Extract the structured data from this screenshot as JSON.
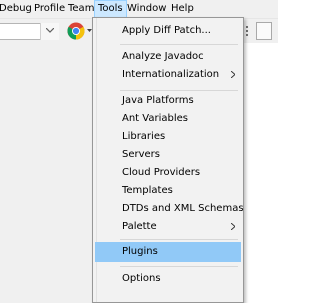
{
  "menubar": {
    "items": [
      "Debug",
      "Profile",
      "Team",
      "Tools",
      "Window",
      "Help"
    ]
  },
  "tools_menu": {
    "items": [
      {
        "label": "Apply Diff Patch...",
        "submenu": false
      },
      {
        "label": "Analyze Javadoc",
        "submenu": false
      },
      {
        "label": "Internationalization",
        "submenu": true
      },
      {
        "label": "Java Platforms",
        "submenu": false
      },
      {
        "label": "Ant Variables",
        "submenu": false
      },
      {
        "label": "Libraries",
        "submenu": false
      },
      {
        "label": "Servers",
        "submenu": false
      },
      {
        "label": "Cloud Providers",
        "submenu": false
      },
      {
        "label": "Templates",
        "submenu": false
      },
      {
        "label": "DTDs and XML Schemas",
        "submenu": false
      },
      {
        "label": "Palette",
        "submenu": true
      },
      {
        "label": "Plugins",
        "submenu": false,
        "highlighted": true
      },
      {
        "label": "Options",
        "submenu": false
      }
    ]
  },
  "toolbar": {
    "browser_icon": "chrome-icon"
  },
  "colors": {
    "menu_bg": "#f2f2f2",
    "highlight": "#91c9f7",
    "active_menu": "#cce8ff"
  }
}
